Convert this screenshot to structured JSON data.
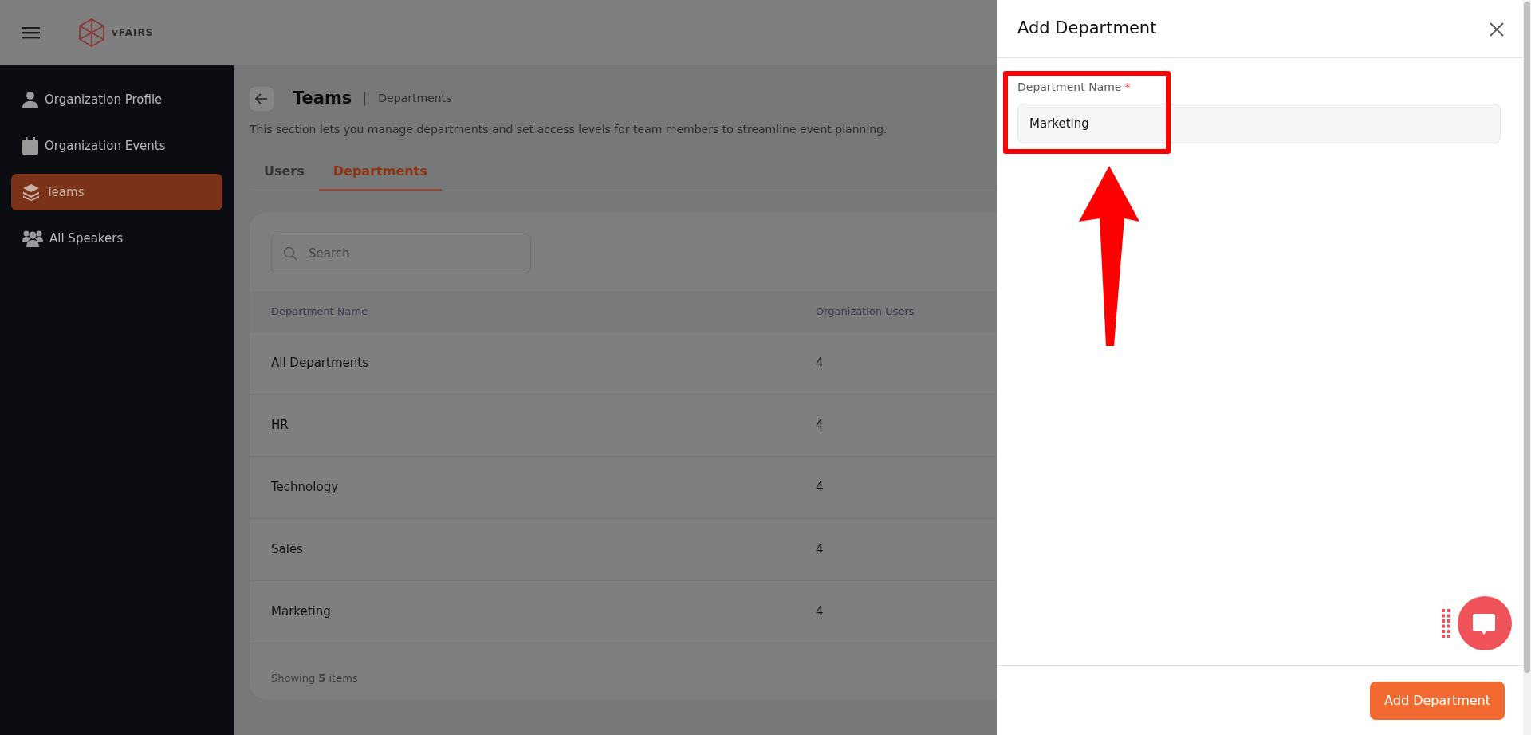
{
  "header": {
    "brand": "vFAIRS"
  },
  "sidebar": {
    "items": [
      {
        "label": "Organization Profile",
        "kind": "person",
        "selected": false
      },
      {
        "label": "Organization Events",
        "kind": "calendar",
        "selected": false
      },
      {
        "label": "Teams",
        "kind": "layers",
        "selected": true
      },
      {
        "label": "All Speakers",
        "kind": "group",
        "selected": false
      }
    ]
  },
  "page": {
    "title": "Teams",
    "breadcrumb": "Departments",
    "description": "This section lets you manage departments and set access levels for team members to streamline event planning.",
    "tabs": [
      {
        "label": "Users",
        "selected": false
      },
      {
        "label": "Departments",
        "selected": true
      }
    ],
    "search": {
      "placeholder": "Search"
    },
    "table": {
      "columns": [
        "Department Name",
        "Organization Users"
      ],
      "rows": [
        [
          "All Departments",
          "4"
        ],
        [
          "HR",
          "4"
        ],
        [
          "Technology",
          "4"
        ],
        [
          "Sales",
          "4"
        ],
        [
          "Marketing",
          "4"
        ]
      ]
    },
    "footer": "Showing **5** items"
  },
  "panel": {
    "title": "Add Department",
    "field": {
      "label": "Department Name",
      "required_mark": "*",
      "value": "Marketing"
    },
    "submit": "Add Department"
  }
}
